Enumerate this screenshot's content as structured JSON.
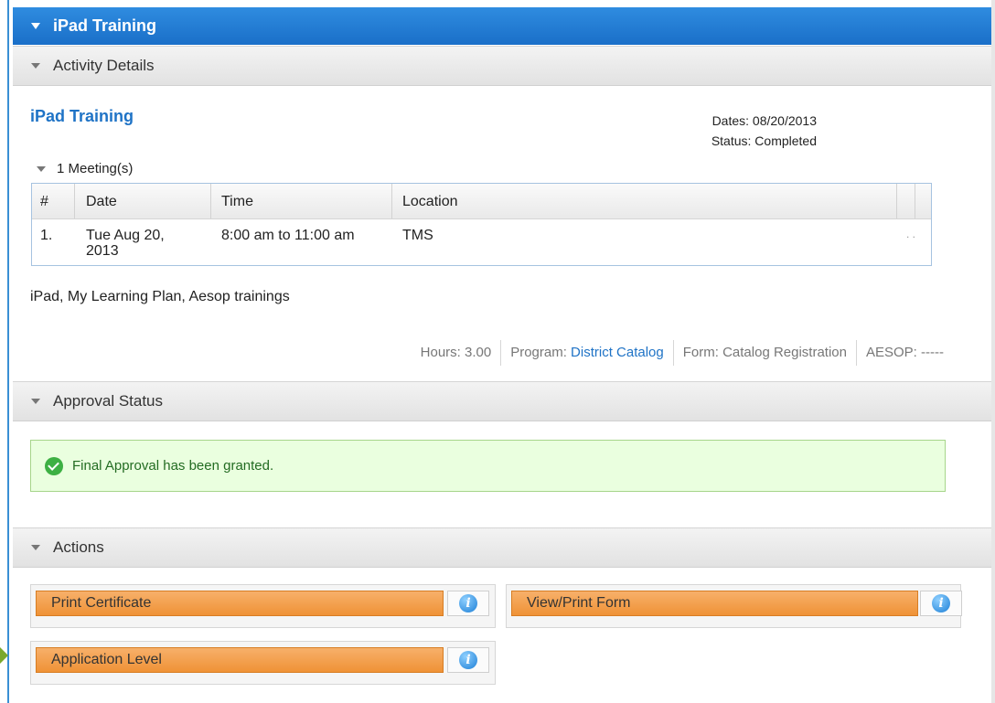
{
  "header": {
    "title": "iPad Training"
  },
  "sections": {
    "details": "Activity Details",
    "approval": "Approval Status",
    "actions": "Actions"
  },
  "activity": {
    "title": "iPad Training",
    "dates_label": "Dates:",
    "dates_value": "08/20/2013",
    "status_label": "Status:",
    "status_value": "Completed",
    "meetings_label": "1 Meeting(s)",
    "description": "iPad, My Learning Plan, Aesop trainings"
  },
  "meetings": {
    "columns": [
      "#",
      "Date",
      "Time",
      "Location"
    ],
    "rows": [
      {
        "num": "1.",
        "date_line1": "Tue Aug 20,",
        "date_line2": "2013",
        "time": "8:00 am to 11:00 am",
        "location": "TMS",
        "extra": ". ."
      }
    ]
  },
  "meta": {
    "hours": "Hours: 3.00",
    "program_label": "Program:",
    "program_link": "District Catalog",
    "form": "Form: Catalog Registration",
    "aesop": "AESOP: -----"
  },
  "approval": {
    "message": "Final Approval has been granted."
  },
  "actions": {
    "print_certificate": "Print Certificate",
    "view_print_form": "View/Print Form",
    "application_level": "Application Level",
    "info_glyph": "i"
  },
  "colors": {
    "header_blue": "#1a6fc8",
    "link_blue": "#1f73c6",
    "action_orange": "#ef9236",
    "approval_green_bg": "#eaffdf"
  }
}
